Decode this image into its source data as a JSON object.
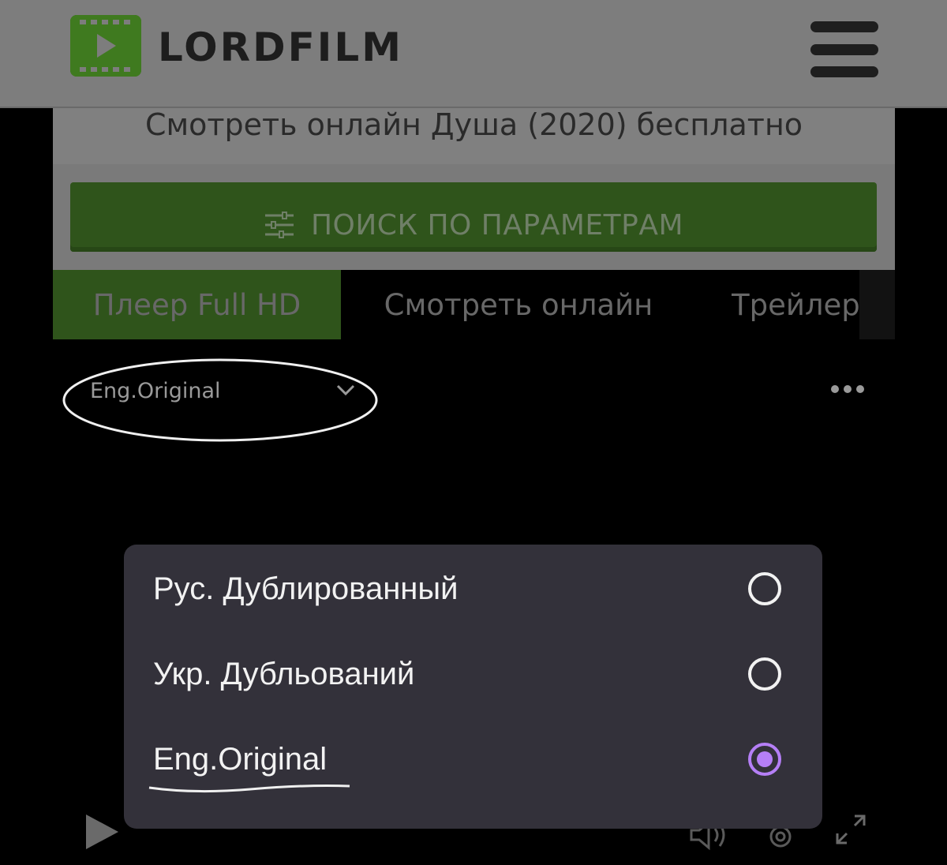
{
  "header": {
    "logo_text": "LORDFILM",
    "colors": {
      "header_bg": "#7d7d7d",
      "logo_green": "#3a6f1e"
    },
    "icons": {
      "logo": "film-play-icon",
      "menu": "hamburger-menu-icon"
    }
  },
  "page": {
    "title": "Смотреть онлайн Душа (2020) бесплатно",
    "search_button": {
      "label": "ПОИСК ПО ПАРАМЕТРАМ",
      "icon": "sliders-icon"
    }
  },
  "tabs": [
    {
      "label": "Плеер Full HD",
      "active": true
    },
    {
      "label": "Смотреть онлайн",
      "active": false
    },
    {
      "label": "Трейлер",
      "active": false
    }
  ],
  "player": {
    "audio_track_selected": "Eng.Original",
    "icons": [
      "chevron-down-icon",
      "more-dots-icon",
      "play-icon",
      "volume-icon",
      "gear-icon",
      "fullscreen-icon"
    ]
  },
  "audio_dialog": {
    "options": [
      {
        "label": "Рус. Дублированный",
        "selected": false
      },
      {
        "label": "Укр. Дубльований",
        "selected": false
      },
      {
        "label": "Eng.Original",
        "selected": true
      }
    ],
    "colors": {
      "dialog_bg": "#33313a",
      "accent": "#b57ff6"
    }
  }
}
